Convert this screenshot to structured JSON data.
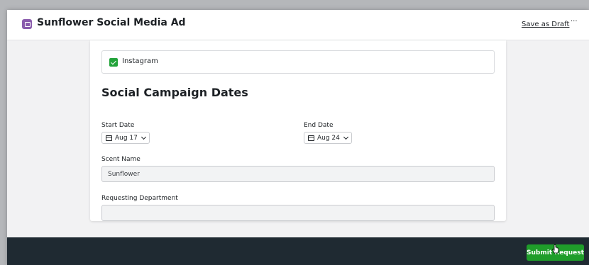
{
  "header": {
    "title": "Sunflower Social Media Ad",
    "save_draft_label": "Save as Draft",
    "more_label": "···"
  },
  "form": {
    "platform_option": {
      "label": "Instagram",
      "checked": true
    },
    "section_title": "Social Campaign Dates",
    "start_date": {
      "label": "Start Date",
      "value": "Aug 17"
    },
    "end_date": {
      "label": "End Date",
      "value": "Aug 24"
    },
    "scent_name": {
      "label": "Scent Name",
      "value": "Sunflower"
    },
    "requesting_department": {
      "label": "Requesting Department",
      "value": ""
    }
  },
  "footer": {
    "submit_label": "Submit Request"
  },
  "colors": {
    "accent_green": "#1f9d2a",
    "footer_bg": "#1f2a32",
    "app_icon": "#8a5cad"
  },
  "icons": [
    "form-icon",
    "checkbox-checked-icon",
    "calendar-icon",
    "chevron-down-icon",
    "more-icon",
    "hand-cursor-icon"
  ]
}
